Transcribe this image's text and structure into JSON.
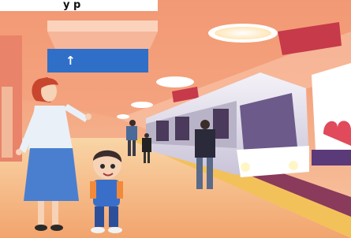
{
  "heading": {
    "visible_text": "y p"
  },
  "sign": {
    "arrow_glyph": "↑"
  },
  "palette": {
    "ceiling": "#f4a27a",
    "wall": "#f7c9a6",
    "floor": "#f3b07a",
    "floor_light": "#f9d6a8",
    "train_body": "#e8e4ef",
    "train_accent": "#c63a4a",
    "track": "#8a3a5a",
    "sign_blue": "#2f6fc7",
    "lamp": "#fff6e0",
    "woman_shirt": "#e9f0f8",
    "woman_skirt": "#4a7fd0",
    "woman_hair": "#c8452e",
    "boy_shirt": "#3a6fc9",
    "boy_hair": "#3a2d2a"
  },
  "scene": {
    "objects": [
      "metro-station",
      "train",
      "platform",
      "ceiling-lamps",
      "direction-sign",
      "woman",
      "boy",
      "passengers",
      "billboard"
    ]
  }
}
